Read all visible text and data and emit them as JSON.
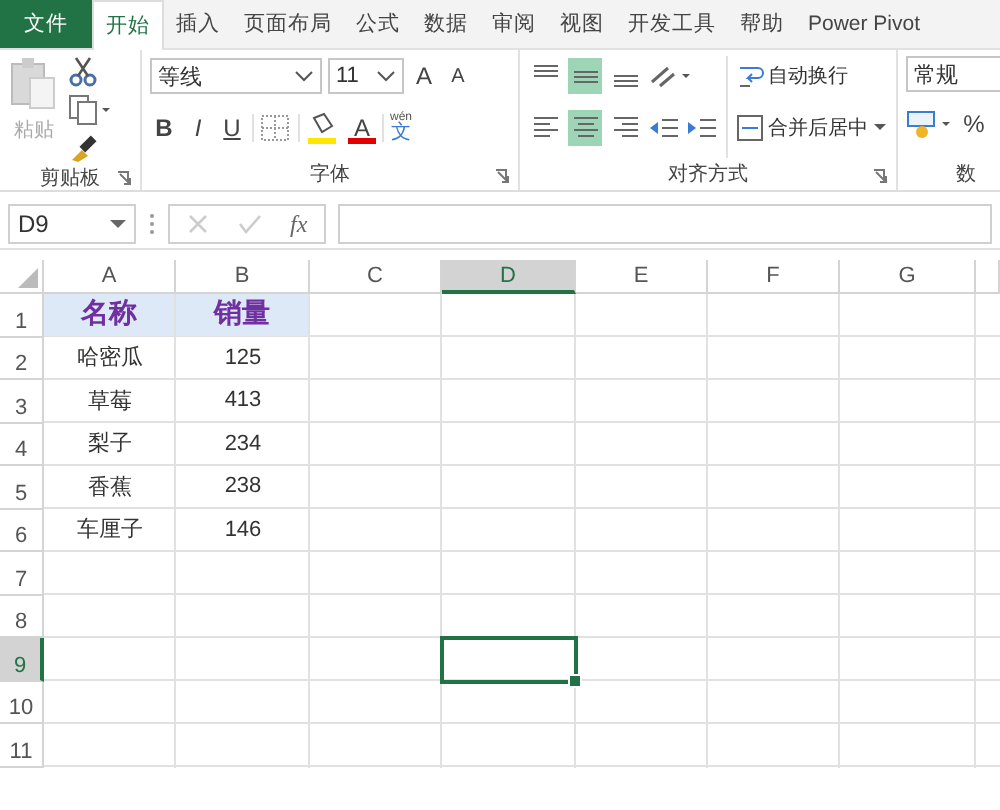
{
  "tabs": [
    {
      "label": "文件",
      "kind": "file",
      "selected": false
    },
    {
      "label": "开始",
      "kind": "tab",
      "selected": true
    },
    {
      "label": "插入",
      "kind": "tab",
      "selected": false
    },
    {
      "label": "页面布局",
      "kind": "tab",
      "selected": false
    },
    {
      "label": "公式",
      "kind": "tab",
      "selected": false
    },
    {
      "label": "数据",
      "kind": "tab",
      "selected": false
    },
    {
      "label": "审阅",
      "kind": "tab",
      "selected": false
    },
    {
      "label": "视图",
      "kind": "tab",
      "selected": false
    },
    {
      "label": "开发工具",
      "kind": "tab",
      "selected": false
    },
    {
      "label": "帮助",
      "kind": "tab",
      "selected": false
    },
    {
      "label": "Power Pivot",
      "kind": "tab",
      "selected": false
    }
  ],
  "clipboard": {
    "paste_label": "粘贴",
    "group_label": "剪贴板"
  },
  "font": {
    "name": "等线",
    "size": "11",
    "grow": "A",
    "shrink": "A",
    "bold": "B",
    "italic": "I",
    "underline": "U",
    "color_letter": "A",
    "phonetic_top": "wén",
    "phonetic_bottom": "文",
    "group_label": "字体"
  },
  "alignment": {
    "vertical": [
      {
        "selected": false
      },
      {
        "selected": true
      },
      {
        "selected": false
      }
    ],
    "horizontal": [
      {
        "selected": false
      },
      {
        "selected": true
      },
      {
        "selected": false
      }
    ],
    "wrap_text": "自动换行",
    "merge_center": "合并后居中",
    "group_label": "对齐方式"
  },
  "number": {
    "format": "常规",
    "percent": "%",
    "group_label": "数"
  },
  "formula_bar": {
    "name_box": "D9",
    "fx": "fx"
  },
  "columns": [
    {
      "label": "A",
      "selected": false
    },
    {
      "label": "B",
      "selected": false
    },
    {
      "label": "C",
      "selected": false
    },
    {
      "label": "D",
      "selected": true
    },
    {
      "label": "E",
      "selected": false
    },
    {
      "label": "F",
      "selected": false
    },
    {
      "label": "G",
      "selected": false
    }
  ],
  "first_row_is_header": true,
  "rows": [
    {
      "label": "1",
      "selected": false,
      "cells": [
        "名称",
        "销量"
      ]
    },
    {
      "label": "2",
      "selected": false,
      "cells": [
        "哈密瓜",
        "125"
      ]
    },
    {
      "label": "3",
      "selected": false,
      "cells": [
        "草莓",
        "413"
      ]
    },
    {
      "label": "4",
      "selected": false,
      "cells": [
        "梨子",
        "234"
      ]
    },
    {
      "label": "5",
      "selected": false,
      "cells": [
        "香蕉",
        "238"
      ]
    },
    {
      "label": "6",
      "selected": false,
      "cells": [
        "车厘子",
        "146"
      ]
    },
    {
      "label": "7",
      "selected": false
    },
    {
      "label": "8",
      "selected": false
    },
    {
      "label": "9",
      "selected": true
    },
    {
      "label": "10",
      "selected": false
    },
    {
      "label": "11",
      "selected": false
    }
  ]
}
